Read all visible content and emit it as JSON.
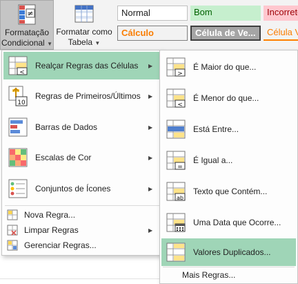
{
  "ribbon": {
    "cond_format": {
      "line1": "Formatação",
      "line2": "Condicional",
      "icon": "conditional-format-icon"
    },
    "format_table": {
      "line1": "Formatar como",
      "line2": "Tabela",
      "icon": "format-table-icon"
    },
    "styles": [
      {
        "label": "Normal",
        "bg": "#ffffff",
        "color": "#000000"
      },
      {
        "label": "Bom",
        "bg": "#c6efce",
        "color": "#006100"
      },
      {
        "label": "Incorreto",
        "bg": "#ffc7ce",
        "color": "#9c0006"
      },
      {
        "label": "Cálculo",
        "bg": "#f2f2f2",
        "color": "#fa7d00"
      },
      {
        "label": "Célula de Ve...",
        "bg": "#a5a5a5",
        "color": "#ffffff"
      },
      {
        "label": "Célula V",
        "bg": "#ffffff",
        "color": "#fa7d00"
      }
    ]
  },
  "menu": {
    "items": [
      {
        "label": "Realçar Regras das Células",
        "icon": "highlight-cells-rules-icon",
        "has_submenu": true,
        "highlighted": true
      },
      {
        "label": "Regras de Primeiros/Últimos",
        "icon": "top-bottom-rules-icon",
        "has_submenu": true,
        "highlighted": false
      },
      {
        "label": "Barras de Dados",
        "icon": "data-bars-icon",
        "has_submenu": true,
        "highlighted": false
      },
      {
        "label": "Escalas de Cor",
        "icon": "color-scales-icon",
        "has_submenu": true,
        "highlighted": false
      },
      {
        "label": "Conjuntos de Ícones",
        "icon": "icon-sets-icon",
        "has_submenu": true,
        "highlighted": false
      }
    ],
    "small_items": [
      {
        "label": "Nova Regra...",
        "icon": "new-rule-icon"
      },
      {
        "label": "Limpar Regras",
        "icon": "clear-rules-icon",
        "has_submenu": true
      },
      {
        "label": "Gerenciar Regras...",
        "icon": "manage-rules-icon"
      }
    ]
  },
  "submenu": {
    "items": [
      {
        "label": "É Maior do que...",
        "icon": "greater-than-icon",
        "highlighted": false
      },
      {
        "label": "É Menor do que...",
        "icon": "less-than-icon",
        "highlighted": false
      },
      {
        "label": "Está Entre...",
        "icon": "between-icon",
        "highlighted": false
      },
      {
        "label": "É Igual a...",
        "icon": "equal-to-icon",
        "highlighted": false
      },
      {
        "label": "Texto que Contém...",
        "icon": "text-contains-icon",
        "highlighted": false
      },
      {
        "label": "Uma Data que Ocorre...",
        "icon": "date-occurring-icon",
        "highlighted": false
      },
      {
        "label": "Valores Duplicados...",
        "icon": "duplicate-values-icon",
        "highlighted": true
      }
    ],
    "more_rules": "Mais Regras..."
  }
}
